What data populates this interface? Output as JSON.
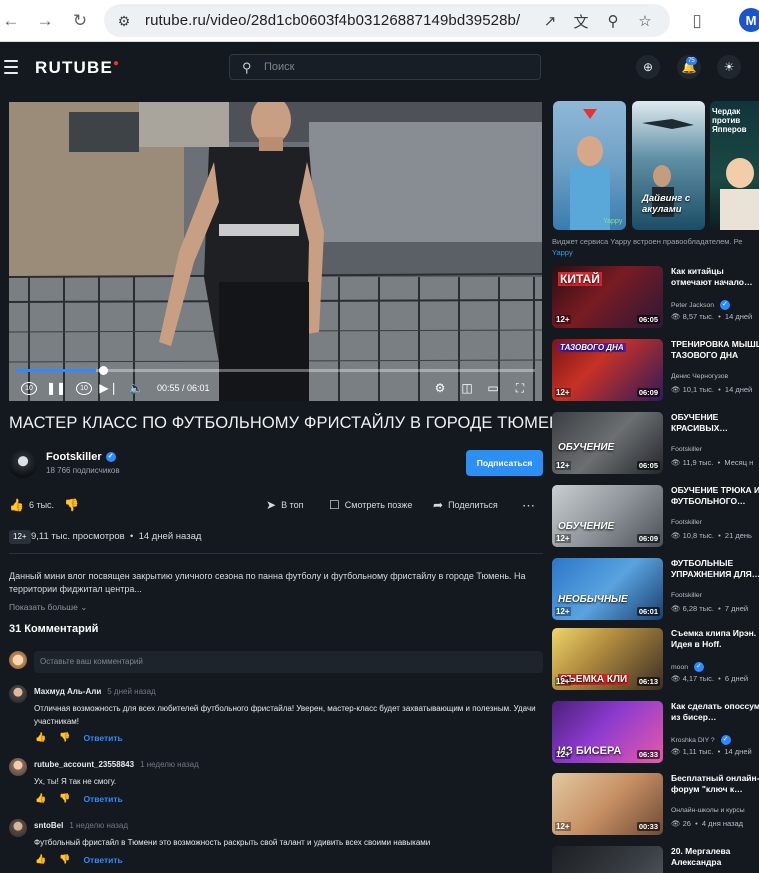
{
  "browser": {
    "url": "rutube.ru/video/28d1cb0603f4b03126887149bd39528b/",
    "profile_initial": "M"
  },
  "header": {
    "logo": "RUTUBE",
    "search_placeholder": "Поиск",
    "notifications_badge": "75"
  },
  "player": {
    "time": "00:55 / 06:01",
    "progress": 0.15,
    "skip_back": "10",
    "skip_forward": "10"
  },
  "video": {
    "title": "МАСТЕР КЛАСС ПО ФУТБОЛЬНОМУ ФРИСТАЙЛУ В ГОРОДЕ ТЮМЕНЬ",
    "channel": "Footskiller",
    "subscribers": "18 766 подписчиков",
    "subscribe_label": "Подписаться",
    "likes": "6 тыс.",
    "actions": {
      "top": "В топ",
      "watch_later": "Смотреть позже",
      "share": "Поделиться"
    },
    "age": "12+",
    "views": "9,11 тыс. просмотров",
    "ago": "14 дней назад",
    "description": "Данный мини влог посвящен закрытию уличного сезона по панна футболу и футбольному фристайлу в городе Тюмень. На территории фиджитал центра...",
    "show_more": "Показать больше"
  },
  "comments": {
    "count_label": "31 Комментарий",
    "input_placeholder": "Оставьте ваш комментарий",
    "reply_label": "Ответить",
    "items": [
      {
        "author": "Махмуд Аль-Али",
        "time": "5 дней назад",
        "text": "Отличная возможность для всех любителей футбольного фристайла! Уверен, мастер-класс будет захватывающим и полезным. Удачи участникам!"
      },
      {
        "author": "rutube_account_23558843",
        "time": "1 неделю назад",
        "text": "Ух, ты! Я так не смогу."
      },
      {
        "author": "sntoBel",
        "time": "1 неделю назад",
        "text": "Футбольный фристайл в Тюмени это возможность раскрыть свой талант и удивить всех своими навыками"
      }
    ]
  },
  "sidebar": {
    "shorts": [
      {
        "caption": ""
      },
      {
        "caption": "Дайвинг с акулами"
      },
      {
        "caption": "Чердак против Япперов"
      }
    ],
    "shorts_note_prefix": "Виджет сервиса Yappy встроен правообладателем. Ре",
    "shorts_note_link": "Yappy",
    "recommendations": [
      {
        "title": "Как китайцы отмечают начало…",
        "channel": "Peter Jackson",
        "views": "8,57 тыс.",
        "ago": "14 дней",
        "age": "12+",
        "duration": "06:05",
        "thumb_text": "КИТАЙ"
      },
      {
        "title": "ТРЕНИРОВКА МЫШЦ ТАЗОВОГО ДНА",
        "channel": "Денис Черногузов",
        "views": "10,1 тыс.",
        "ago": "14 дней",
        "age": "12+",
        "duration": "06:09",
        "thumb_text": "ТАЗОВОГО ДНА"
      },
      {
        "title": "ОБУЧЕНИЕ КРАСИВЫХ…",
        "channel": "Footskiller",
        "views": "11,9 тыс.",
        "ago": "Месяц н",
        "age": "12+",
        "duration": "06:05",
        "thumb_text": "ОБУЧЕНИЕ"
      },
      {
        "title": "ОБУЧЕНИЕ ТРЮКА ИЗ ФУТБОЛЬНОГО…",
        "channel": "Footskiller",
        "views": "10,8 тыс.",
        "ago": "21 день",
        "age": "12+",
        "duration": "06:09",
        "thumb_text": "ОБУЧЕНИЕ"
      },
      {
        "title": "ФУТБОЛЬНЫЕ УПРАЖНЕНИЯ ДЛЯ…",
        "channel": "Footskiller",
        "views": "6,28 тыс.",
        "ago": "7 дней",
        "age": "12+",
        "duration": "06:01",
        "thumb_text": "НЕОБЫЧНЫЕ"
      },
      {
        "title": "Съемка клипа Ирэн. Идея в Hoff.",
        "channel": "moon",
        "views": "4,17 тыс.",
        "ago": "6 дней",
        "age": "12+",
        "duration": "06:13",
        "thumb_text": "СЪЕМКА КЛИ"
      },
      {
        "title": "Как сделать опоссума из бисер…",
        "channel": "Kroshka DIY ?",
        "views": "1,11 тыс.",
        "ago": "14 дней",
        "age": "12+",
        "duration": "06:33",
        "thumb_text": "ИЗ БИСЕРА"
      },
      {
        "title": "Бесплатный онлайн-форум \"ключ к…",
        "channel": "Онлайн-школы и курсы",
        "views": "26",
        "ago": "4 дня назад",
        "age": "12+",
        "duration": "00:33",
        "thumb_text": ""
      },
      {
        "title": "20. Мергалева Александра",
        "channel": "",
        "views": "",
        "ago": "",
        "age": "",
        "duration": "",
        "thumb_text": ""
      }
    ]
  }
}
